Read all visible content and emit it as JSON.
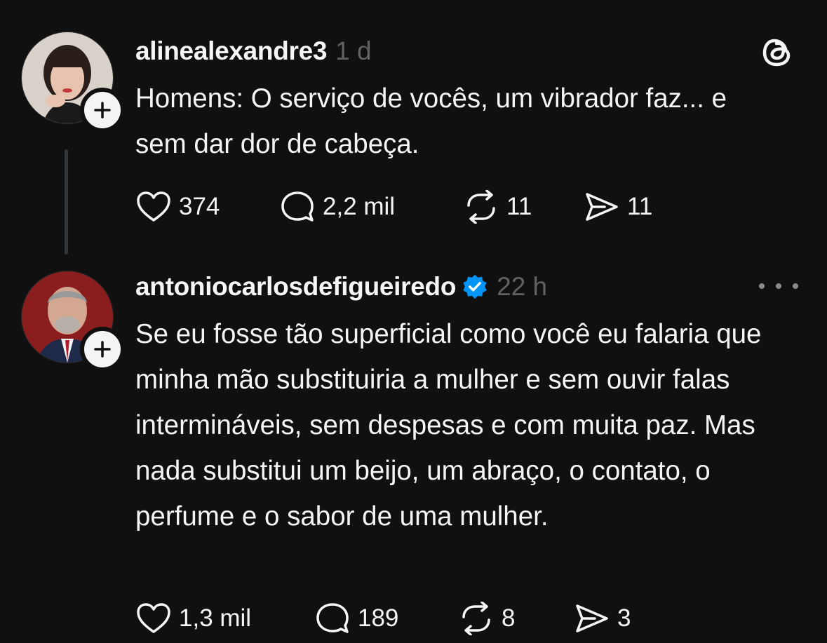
{
  "app": {
    "logo_icon": "threads-logo-icon"
  },
  "posts": [
    {
      "username": "alinealexandre3",
      "time": "1 d",
      "verified": false,
      "avatar_icon": "avatar-woman",
      "text": "Homens: O serviço de vocês, um vibrador faz... e sem dar dor de cabeça.",
      "actions": {
        "likes": "374",
        "replies": "2,2 mil",
        "reposts": "11",
        "shares": "11"
      }
    },
    {
      "username": "antoniocarlosdefigueiredo",
      "time": "22 h",
      "verified": true,
      "avatar_icon": "avatar-man",
      "text": "Se eu fosse tão superficial como você eu falaria que minha mão substituiria a mulher e sem ouvir falas intermináveis, sem despesas e com muita paz. Mas nada substitui um beijo, um abraço, o contato, o perfume e o sabor de uma mulher.",
      "actions": {
        "likes": "1,3 mil",
        "replies": "189",
        "reposts": "8",
        "shares": "3"
      }
    }
  ],
  "colors": {
    "background": "#101010",
    "text": "#f3f5f7",
    "muted": "#616161",
    "verified": "#0095f6",
    "thread_line": "#333638"
  }
}
